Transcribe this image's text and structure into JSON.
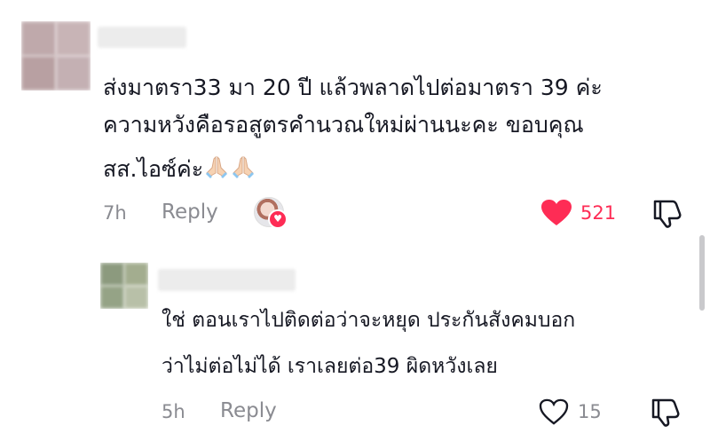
{
  "comments": [
    {
      "username": "",
      "text_lines": [
        "ส่งมาตรา33 มา 20 ปี แล้วพลาดไปต่อมาตรา 39 ค่ะ",
        "ความหวังคือรอสูตรคำนวณใหม่ผ่านนะคะ ขอบคุณ",
        "สส.ไอซ์ค่ะ"
      ],
      "emoji": [
        "praying-hands",
        "praying-hands"
      ],
      "time": "7h",
      "reply_label": "Reply",
      "creator_liked": true,
      "liked": true,
      "like_count": "521",
      "like_color": "#fe2c55"
    },
    {
      "username": "",
      "text_lines": [
        "ใช่ ตอนเราไปติดต่อว่าจะหยุด ประกันสังคมบอก",
        "ว่าไม่ต่อไม่ได้ เราเลยต่อ39 ผิดหวังเลย"
      ],
      "time": "5h",
      "reply_label": "Reply",
      "liked": false,
      "like_count": "15"
    }
  ]
}
